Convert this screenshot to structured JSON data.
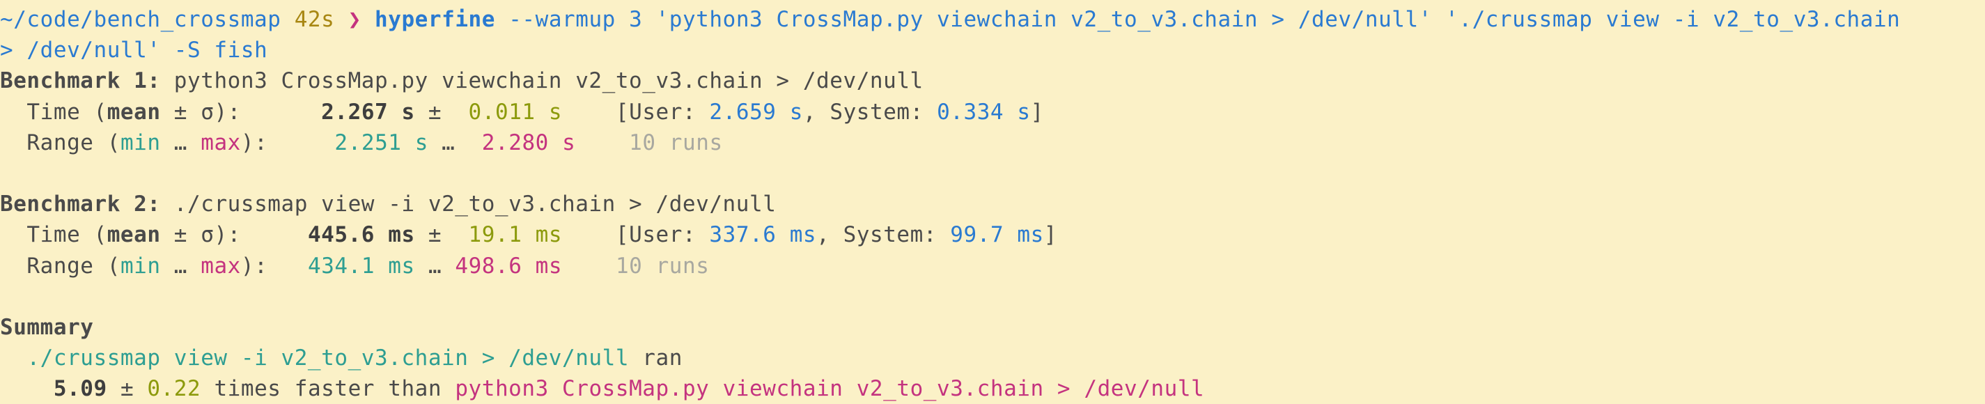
{
  "prompt": {
    "cwd": "~/code/bench_crossmap",
    "duration": "42s",
    "arrow": "❯",
    "command": "hyperfine",
    "args_line1": "--warmup 3 'python3 CrossMap.py viewchain v2_to_v3.chain > /dev/null' './crussmap view -i v2_to_v3.chain",
    "args_line2": "> /dev/null' -S fish"
  },
  "benchmarks": [
    {
      "heading": "Benchmark 1:",
      "command": "python3 CrossMap.py viewchain v2_to_v3.chain > /dev/null",
      "time_label_start": "  Time (",
      "mean_word": "mean",
      "pm_sigma": " ± σ",
      "time_label_end": "):",
      "mean_value": "2.267 s",
      "pm": "±",
      "sigma_value": "0.011 s",
      "user_label": "[User:",
      "user_value": "2.659 s",
      "system_label": ", System:",
      "system_value": "0.334 s",
      "close_bracket": "]",
      "range_label_start": "  Range (",
      "min_word": "min",
      "ellipsis": " … ",
      "max_word": "max",
      "range_label_end": "):",
      "min_value": "2.251 s",
      "range_sep": "…",
      "max_value": "2.280 s",
      "runs": "10 runs"
    },
    {
      "heading": "Benchmark 2:",
      "command": "./crussmap view -i v2_to_v3.chain > /dev/null",
      "time_label_start": "  Time (",
      "mean_word": "mean",
      "pm_sigma": " ± σ",
      "time_label_end": "):",
      "mean_value": "445.6 ms",
      "pm": "±",
      "sigma_value": "19.1 ms",
      "user_label": "[User:",
      "user_value": "337.6 ms",
      "system_label": ", System:",
      "system_value": "99.7 ms",
      "close_bracket": "]",
      "range_label_start": "  Range (",
      "min_word": "min",
      "ellipsis": " … ",
      "max_word": "max",
      "range_label_end": "):",
      "min_value": "434.1 ms",
      "range_sep": "…",
      "max_value": "498.6 ms",
      "runs": "10 runs"
    }
  ],
  "summary": {
    "heading": "Summary",
    "fastest_command": "./crussmap view -i v2_to_v3.chain > /dev/null",
    "ran": "ran",
    "factor": "5.09",
    "pm": "±",
    "factor_err": "0.22",
    "faster_text": "times faster than",
    "slower_command": "python3 CrossMap.py viewchain v2_to_v3.chain > /dev/null"
  }
}
